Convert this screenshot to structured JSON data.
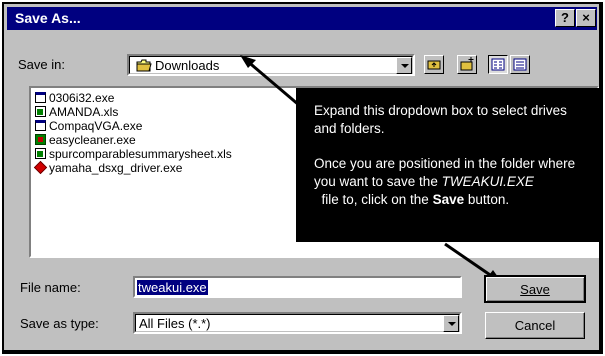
{
  "window": {
    "title": "Save As...",
    "help_button": "?",
    "close_button": "×"
  },
  "save_in": {
    "label": "Save in:",
    "value": "Downloads"
  },
  "files": [
    {
      "name": "0306i32.exe",
      "icon": "exe-icon"
    },
    {
      "name": "AMANDA.xls",
      "icon": "excel-file-icon"
    },
    {
      "name": "CompaqVGA.exe",
      "icon": "exe-icon"
    },
    {
      "name": "easycleaner.exe",
      "icon": "app-icon"
    },
    {
      "name": "spurcomparablesummarysheet.xls",
      "icon": "excel-file-icon"
    },
    {
      "name": "yamaha_dsxg_driver.exe",
      "icon": "installer-icon"
    }
  ],
  "callout": {
    "line1": "Expand this dropdown box to select drives and folders.",
    "line2_pre": "Once you are positioned in the folder where you want to save the ",
    "line2_italic": "TWEAKUI.EXE",
    "line2_mid": "  file to, click on the ",
    "line2_bold": "Save",
    "line2_post": " button."
  },
  "file_name": {
    "label": "File name:",
    "value": "tweakui.exe"
  },
  "save_as_type": {
    "label": "Save as type:",
    "value": "All Files (*.*)"
  },
  "buttons": {
    "save": "Save",
    "cancel": "Cancel"
  },
  "colors": {
    "title_bar": "#000080",
    "dialog_face": "#c0c0c0",
    "callout_bg": "#000000",
    "selection": "#000080"
  }
}
